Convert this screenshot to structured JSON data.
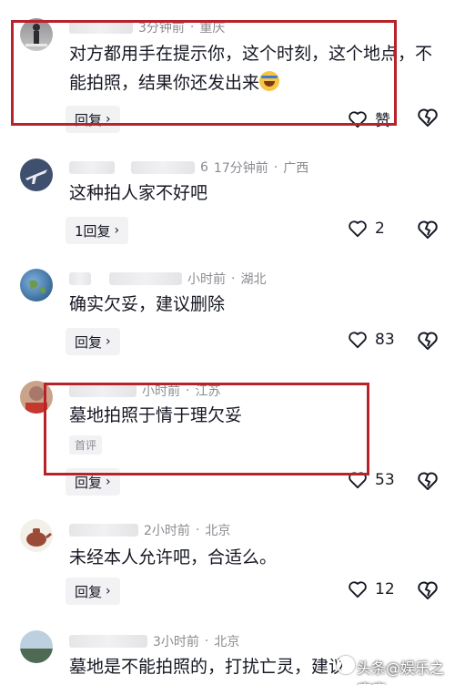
{
  "comments": [
    {
      "meta": {
        "time": "3分钟前",
        "location": "重庆"
      },
      "text": "对方都用手在提示你，这个时刻，这个地点，不能拍照，结果你还发出来",
      "reply_label": "回复",
      "likes": "赞",
      "emoji": "laughing-crying-emoji"
    },
    {
      "meta": {
        "suffix": "6",
        "time": "17分钟前",
        "location": "广西"
      },
      "text": "这种拍人家不好吧",
      "reply_label": "1回复",
      "likes": "2"
    },
    {
      "meta": {
        "time": "小时前",
        "location": "湖北"
      },
      "text": "确实欠妥，建议删除",
      "reply_label": "回复",
      "likes": "83"
    },
    {
      "meta": {
        "time": "小时前",
        "location": "江苏"
      },
      "text": "墓地拍照于情于理欠妥",
      "badge": "首评",
      "reply_label": "回复",
      "likes": "53"
    },
    {
      "meta": {
        "time": "2小时前",
        "location": "北京"
      },
      "text": "未经本人允许吧，合适么。",
      "reply_label": "回复",
      "likes": "12"
    },
    {
      "meta": {
        "time": "3小时前",
        "location": "北京"
      },
      "text": "墓地是不能拍照的，打扰亡灵，建议"
    }
  ],
  "separator": "·",
  "watermark": "头条@娱乐之唐唐",
  "colors": {
    "highlight_box": "#b8232a",
    "meta_text": "#8a8b91"
  }
}
